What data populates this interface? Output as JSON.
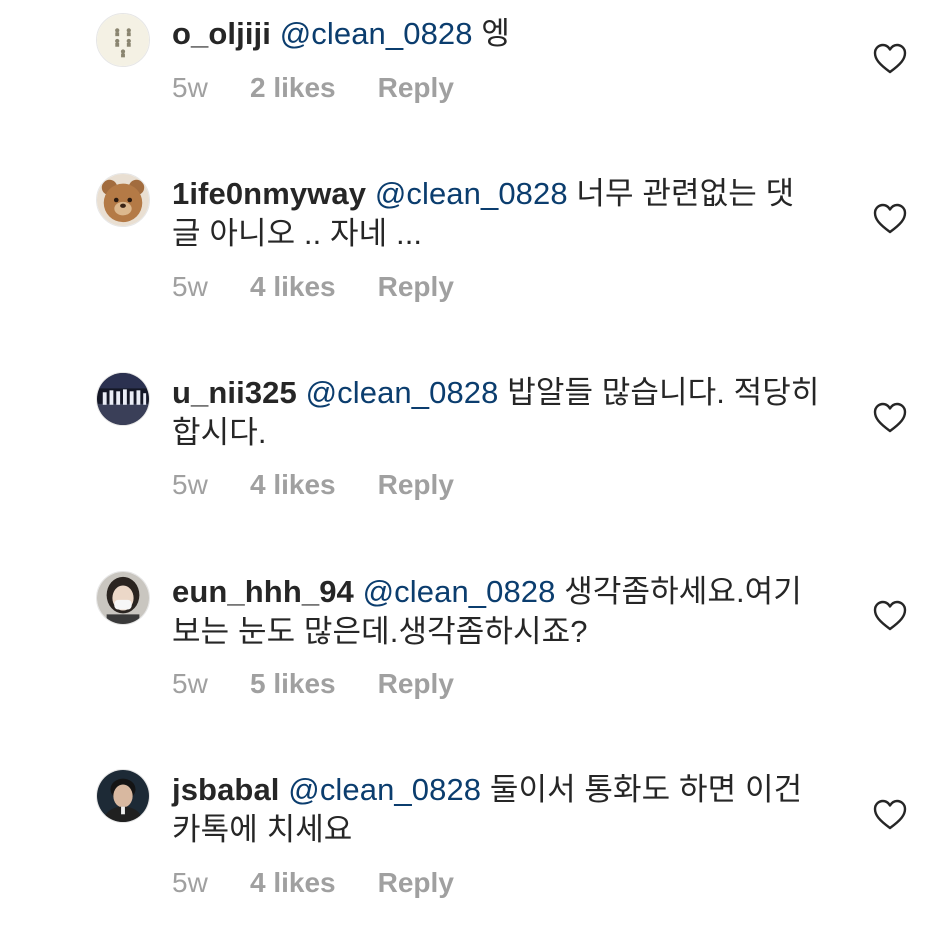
{
  "comments": [
    {
      "username": "o_oljiji",
      "mention": "@clean_0828",
      "text": "엥",
      "time": "5w",
      "likes": "2 likes",
      "reply": "Reply"
    },
    {
      "username": "1ife0nmyway",
      "mention": "@clean_0828",
      "text": "너무 관련없는 댓글 아니오 .. 자네 ...",
      "time": "5w",
      "likes": "4 likes",
      "reply": "Reply"
    },
    {
      "username": "u_nii325",
      "mention": "@clean_0828",
      "text": "밥알들 많습니다. 적당히 합시다.",
      "time": "5w",
      "likes": "4 likes",
      "reply": "Reply"
    },
    {
      "username": "eun_hhh_94",
      "mention": "@clean_0828",
      "text": "생각좀하세요.여기 보는 눈도 많은데.생각좀하시죠?",
      "time": "5w",
      "likes": "5 likes",
      "reply": "Reply"
    },
    {
      "username": "jsbabal",
      "mention": "@clean_0828",
      "text": "둘이서 통화도 하면 이건 카톡에 치세요",
      "time": "5w",
      "likes": "4 likes",
      "reply": "Reply"
    }
  ],
  "icons": {
    "like": "heart-outline-icon",
    "avatar": "avatar"
  },
  "colors": {
    "mention": "#0b3d6e",
    "meta": "#a0a0a0",
    "text": "#262626"
  }
}
